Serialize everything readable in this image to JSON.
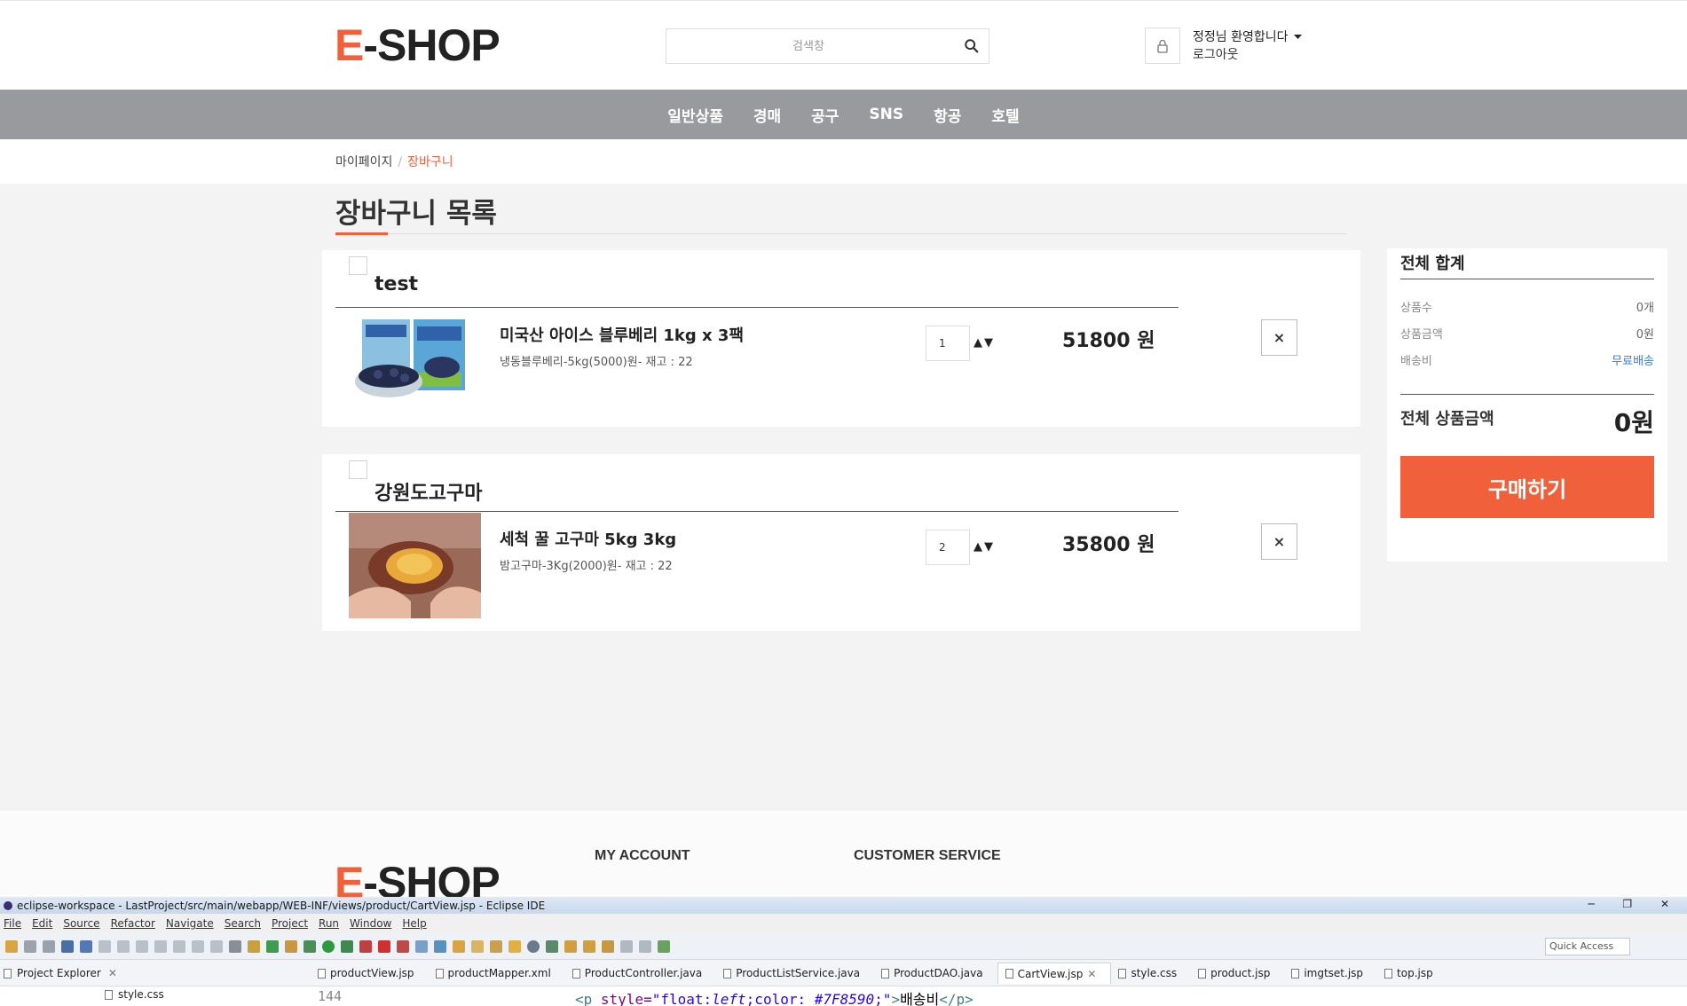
{
  "header": {
    "logo_e": "E",
    "logo_rest": "-SHOP",
    "search_placeholder": "검색창",
    "welcome": "정정님 환영합니다",
    "logout": "로그아웃"
  },
  "nav": [
    "일반상품",
    "경매",
    "공구",
    "SNS",
    "항공",
    "호텔"
  ],
  "breadcrumb": {
    "parent": "마이페이지",
    "sep": "/",
    "current": "장바구니"
  },
  "page_title": "장바구니 목록",
  "cart": [
    {
      "shop": "test",
      "product": "미국산 아이스 블루베리 1kg x 3팩",
      "option": "냉동블루베리-5kg(5000)원- 재고 : 22",
      "qty": "1",
      "arrows": "▲▼",
      "price": "51800 원",
      "delete": "×"
    },
    {
      "shop": "강원도고구마",
      "product": "세척 꿀 고구마 5kg 3kg",
      "option": "밤고구마-3Kg(2000)원- 재고 : 22",
      "qty": "2",
      "arrows": "▲▼",
      "price": "35800 원",
      "delete": "×"
    }
  ],
  "summary": {
    "title": "전체 합계",
    "rows": [
      {
        "label": "상품수",
        "value": "0개"
      },
      {
        "label": "상품금액",
        "value": "0원"
      },
      {
        "label": "배송비",
        "value": "무료배송"
      }
    ],
    "total_label": "전체 상품금액",
    "total_value": "0원",
    "buy": "구매하기"
  },
  "footer": {
    "col1": "MY ACCOUNT",
    "col2": "CUSTOMER SERVICE"
  },
  "ide": {
    "title": "eclipse-workspace - LastProject/src/main/webapp/WEB-INF/views/product/CartView.jsp - Eclipse IDE",
    "window_controls": "─ ❐ ✕",
    "menu": [
      "File",
      "Edit",
      "Source",
      "Refactor",
      "Navigate",
      "Search",
      "Project",
      "Run",
      "Window",
      "Help"
    ],
    "quick_access": "Quick Access",
    "project_explorer": "Project Explorer",
    "tabs": [
      "productView.jsp",
      "productMapper.xml",
      "ProductController.java",
      "ProductListService.java",
      "ProductDAO.java",
      "CartView.jsp",
      "style.css",
      "product.jsp",
      "imgtset.jsp",
      "top.jsp"
    ],
    "active_tab": "CartView.jsp",
    "tree_item": "style.css",
    "line_no": "144",
    "code": {
      "open": "<p ",
      "attr": "style=",
      "q1": "\"float:",
      "val": "left",
      "q2": ";color: ",
      "color": "#7F8590",
      "q3": ";\"",
      "gt": ">",
      "text": "배송비",
      "close": "</p>"
    }
  }
}
